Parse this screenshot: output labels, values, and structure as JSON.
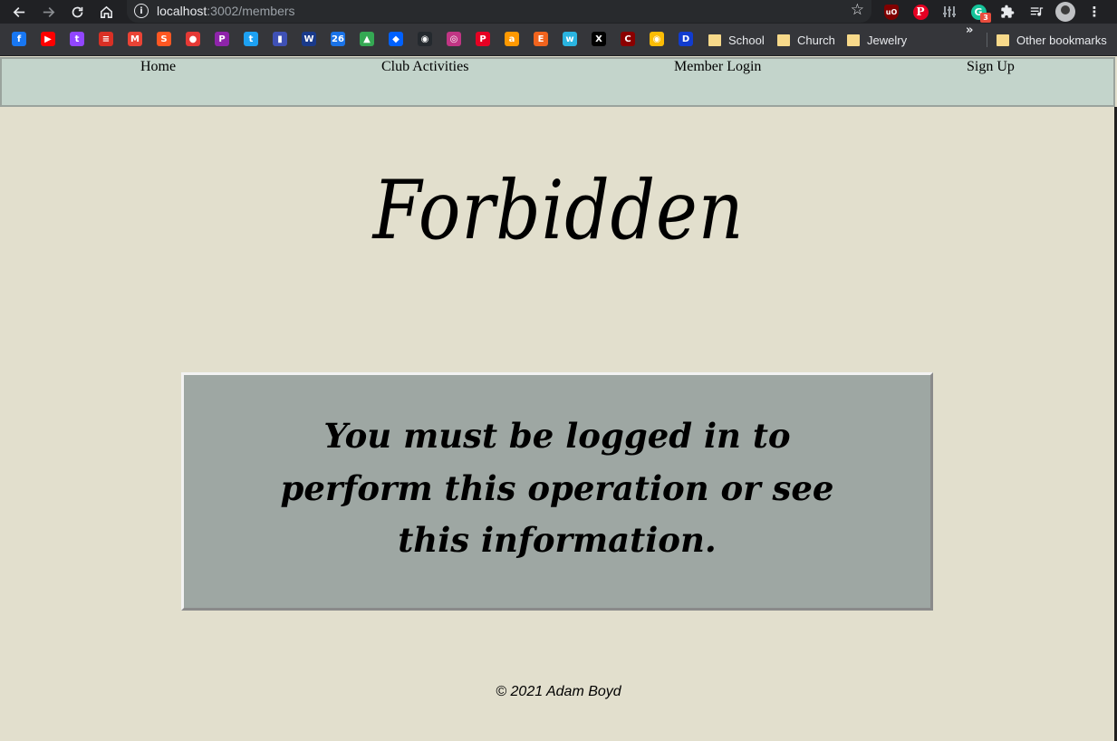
{
  "browser": {
    "url_host": "localhost",
    "url_path": ":3002/members",
    "extension_badge": "3",
    "ub_label": "uO",
    "pin_label": "P",
    "gram_label": "G"
  },
  "bookmarks": {
    "icons": [
      {
        "name": "facebook-icon",
        "color": "#1877f2",
        "glyph": "f"
      },
      {
        "name": "youtube-icon",
        "color": "#ff0000",
        "glyph": "▶"
      },
      {
        "name": "twitch-icon",
        "color": "#9146ff",
        "glyph": "t"
      },
      {
        "name": "news-icon",
        "color": "#d93025",
        "glyph": "≡"
      },
      {
        "name": "gmail-icon",
        "color": "#ea4335",
        "glyph": "M"
      },
      {
        "name": "strawpoll-icon",
        "color": "#ff5722",
        "glyph": "S"
      },
      {
        "name": "tomato-icon",
        "color": "#e53935",
        "glyph": "●"
      },
      {
        "name": "flag-icon",
        "color": "#8e24aa",
        "glyph": "P"
      },
      {
        "name": "twitter-icon",
        "color": "#1da1f2",
        "glyph": "t"
      },
      {
        "name": "gift-icon",
        "color": "#3f51b5",
        "glyph": "▮"
      },
      {
        "name": "weather-channel-icon",
        "color": "#1a3a8a",
        "glyph": "W"
      },
      {
        "name": "calendar-icon",
        "color": "#1a73e8",
        "glyph": "26"
      },
      {
        "name": "drive-icon",
        "color": "#34a853",
        "glyph": "▲"
      },
      {
        "name": "dropbox-icon",
        "color": "#0061ff",
        "glyph": "◆"
      },
      {
        "name": "github-icon",
        "color": "#24292e",
        "glyph": "◉"
      },
      {
        "name": "instagram-icon",
        "color": "#c13584",
        "glyph": "◎"
      },
      {
        "name": "pinterest-icon",
        "color": "#e60023",
        "glyph": "P"
      },
      {
        "name": "amazon-icon",
        "color": "#ff9900",
        "glyph": "a"
      },
      {
        "name": "etsy-icon",
        "color": "#f1641e",
        "glyph": "E"
      },
      {
        "name": "wix-icon",
        "color": "#2ab4e0",
        "glyph": "w"
      },
      {
        "name": "x-icon",
        "color": "#000000",
        "glyph": "X"
      },
      {
        "name": "c-logo-icon",
        "color": "#8b0000",
        "glyph": "C"
      },
      {
        "name": "chrome-icon",
        "color": "#fbbc05",
        "glyph": "◉"
      },
      {
        "name": "disney-icon",
        "color": "#113ccf",
        "glyph": "D"
      }
    ],
    "folders": [
      {
        "name": "school",
        "label": "School"
      },
      {
        "name": "church",
        "label": "Church"
      },
      {
        "name": "jewelry",
        "label": "Jewelry"
      }
    ],
    "overflow_glyph": "»",
    "other_label": "Other bookmarks"
  },
  "nav": {
    "items": [
      {
        "label": "Home"
      },
      {
        "label": "Club Activities"
      },
      {
        "label": "Member Login"
      },
      {
        "label": "Sign Up"
      }
    ]
  },
  "content": {
    "title": "Forbidden",
    "message": "You must be logged in to perform this operation or see this information."
  },
  "footer": {
    "text": "© 2021 Adam Boyd"
  }
}
